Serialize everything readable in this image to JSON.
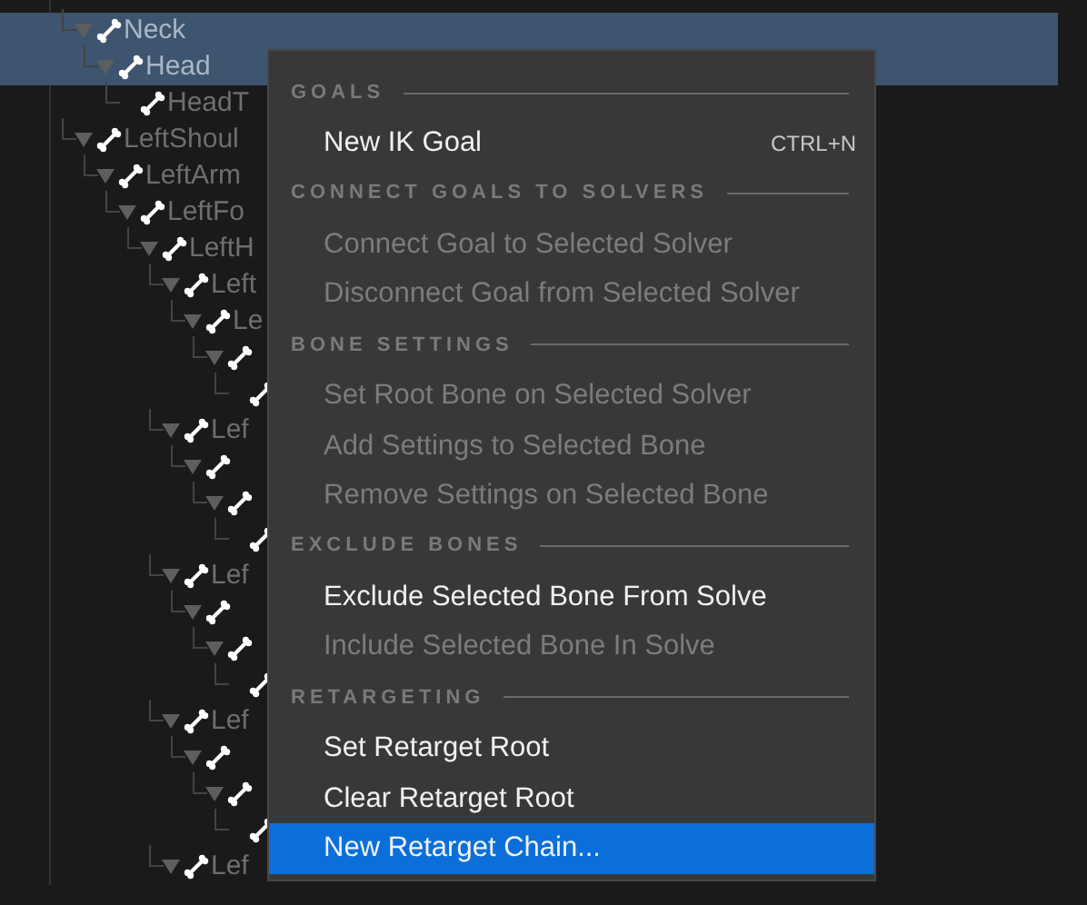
{
  "tree": [
    {
      "label": "Neck",
      "expanded": true,
      "selected": true,
      "children": [
        {
          "label": "Head",
          "expanded": true,
          "selected": true,
          "children": [
            {
              "label": "HeadT",
              "selected": false
            }
          ]
        }
      ]
    },
    {
      "label": "LeftShoul",
      "expanded": true,
      "selected": false,
      "children": [
        {
          "label": "LeftArm",
          "expanded": true,
          "selected": false,
          "children": [
            {
              "label": "LeftFo",
              "expanded": true,
              "selected": false,
              "children": [
                {
                  "label": "LeftH",
                  "expanded": true,
                  "selected": false,
                  "children": [
                    {
                      "label": "Left",
                      "expanded": true,
                      "selected": false,
                      "children": [
                        {
                          "label": "Le",
                          "expanded": true,
                          "selected": false,
                          "children": [
                            {
                              "expanded": true,
                              "selected": false,
                              "children": [
                                {
                                  "selected": false
                                }
                              ]
                            }
                          ]
                        }
                      ]
                    },
                    {
                      "label": "Lef",
                      "expanded": true,
                      "selected": false,
                      "children": [
                        {
                          "expanded": true,
                          "selected": false,
                          "children": [
                            {
                              "expanded": true,
                              "selected": false,
                              "children": [
                                {
                                  "selected": false
                                }
                              ]
                            }
                          ]
                        }
                      ]
                    },
                    {
                      "label": "Lef",
                      "expanded": true,
                      "selected": false,
                      "children": [
                        {
                          "expanded": true,
                          "selected": false,
                          "children": [
                            {
                              "expanded": true,
                              "selected": false,
                              "children": [
                                {
                                  "selected": false
                                }
                              ]
                            }
                          ]
                        }
                      ]
                    },
                    {
                      "label": "Lef",
                      "expanded": true,
                      "selected": false,
                      "children": [
                        {
                          "expanded": true,
                          "selected": false,
                          "children": [
                            {
                              "expanded": true,
                              "selected": false,
                              "children": [
                                {
                                  "selected": false
                                }
                              ]
                            }
                          ]
                        }
                      ]
                    },
                    {
                      "label": "Lef",
                      "expanded": true,
                      "selected": false
                    }
                  ]
                }
              ]
            }
          ]
        }
      ]
    }
  ],
  "context_menu": {
    "sections": [
      {
        "heading": "GOALS",
        "items": [
          {
            "label": "New IK Goal",
            "shortcut": "CTRL+N",
            "disabled": false,
            "selected": false
          }
        ]
      },
      {
        "heading": "CONNECT GOALS TO SOLVERS",
        "items": [
          {
            "label": "Connect Goal to Selected Solver",
            "disabled": true,
            "selected": false
          },
          {
            "label": "Disconnect Goal from Selected Solver",
            "disabled": true,
            "selected": false
          }
        ]
      },
      {
        "heading": "BONE SETTINGS",
        "items": [
          {
            "label": "Set Root Bone on Selected Solver",
            "disabled": true,
            "selected": false
          },
          {
            "label": "Add Settings to Selected Bone",
            "disabled": true,
            "selected": false
          },
          {
            "label": "Remove Settings on Selected Bone",
            "disabled": true,
            "selected": false
          }
        ]
      },
      {
        "heading": "EXCLUDE BONES",
        "items": [
          {
            "label": "Exclude Selected Bone From Solve",
            "disabled": false,
            "selected": false
          },
          {
            "label": "Include Selected Bone In Solve",
            "disabled": true,
            "selected": false
          }
        ]
      },
      {
        "heading": "RETARGETING",
        "items": [
          {
            "label": "Set Retarget Root",
            "disabled": false,
            "selected": false
          },
          {
            "label": "Clear Retarget Root",
            "disabled": false,
            "selected": false
          },
          {
            "label": "New Retarget Chain...",
            "disabled": false,
            "selected": true
          }
        ]
      }
    ]
  }
}
